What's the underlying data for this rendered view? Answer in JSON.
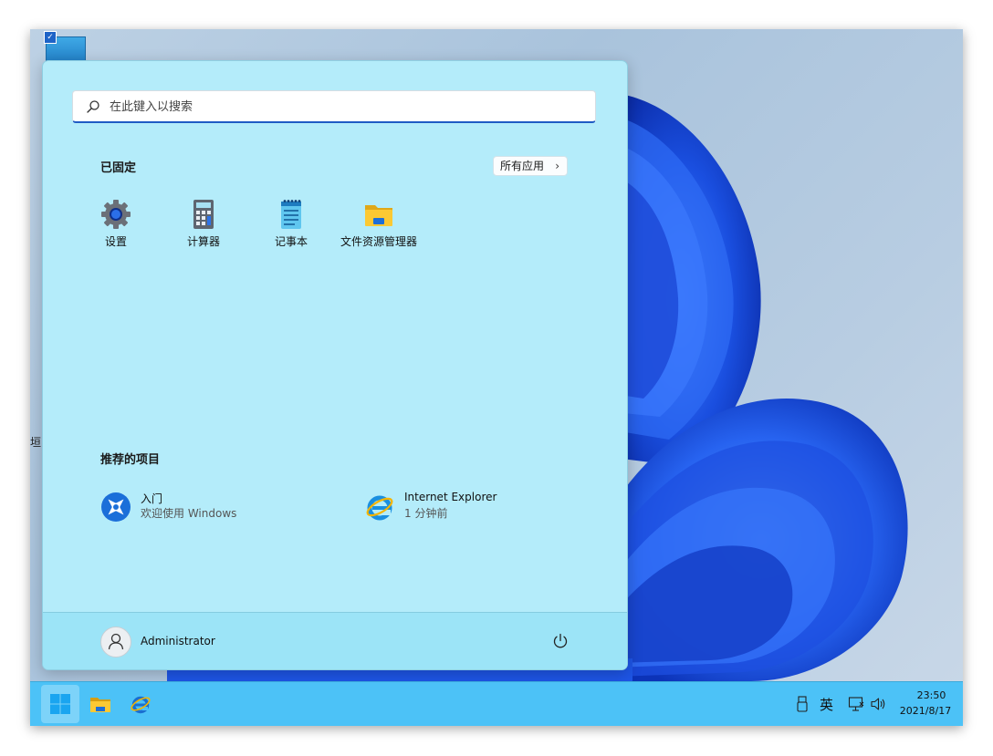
{
  "search": {
    "placeholder": "在此键入以搜索",
    "icon": "search-icon"
  },
  "pinned": {
    "title": "已固定",
    "all_apps_label": "所有应用",
    "all_apps_chevron": "›",
    "items": [
      {
        "label": "设置",
        "icon": "gear-icon"
      },
      {
        "label": "计算器",
        "icon": "calculator-icon"
      },
      {
        "label": "记事本",
        "icon": "notepad-icon"
      },
      {
        "label": "文件资源管理器",
        "icon": "folder-icon"
      }
    ]
  },
  "recommended": {
    "title": "推荐的项目",
    "items": [
      {
        "title": "入门",
        "subtitle": "欢迎使用 Windows",
        "icon": "get-started-icon"
      },
      {
        "title": "Internet Explorer",
        "subtitle": "1 分钟前",
        "icon": "internet-explorer-icon"
      }
    ]
  },
  "user": {
    "name": "Administrator",
    "icon": "user-icon"
  },
  "taskbar": {
    "apps": [
      "windows-start-icon",
      "folder-icon",
      "internet-explorer-icon"
    ],
    "tray": {
      "ime": "英",
      "time": "23:50",
      "date": "2021/8/17"
    }
  },
  "desktop": {
    "edge_text": "垣"
  },
  "colors": {
    "start_bg": "#b4ecfa",
    "footer_bg": "#9ce4f7",
    "taskbar_bg": "#4cc2f7",
    "accent": "#1f5bc4"
  }
}
